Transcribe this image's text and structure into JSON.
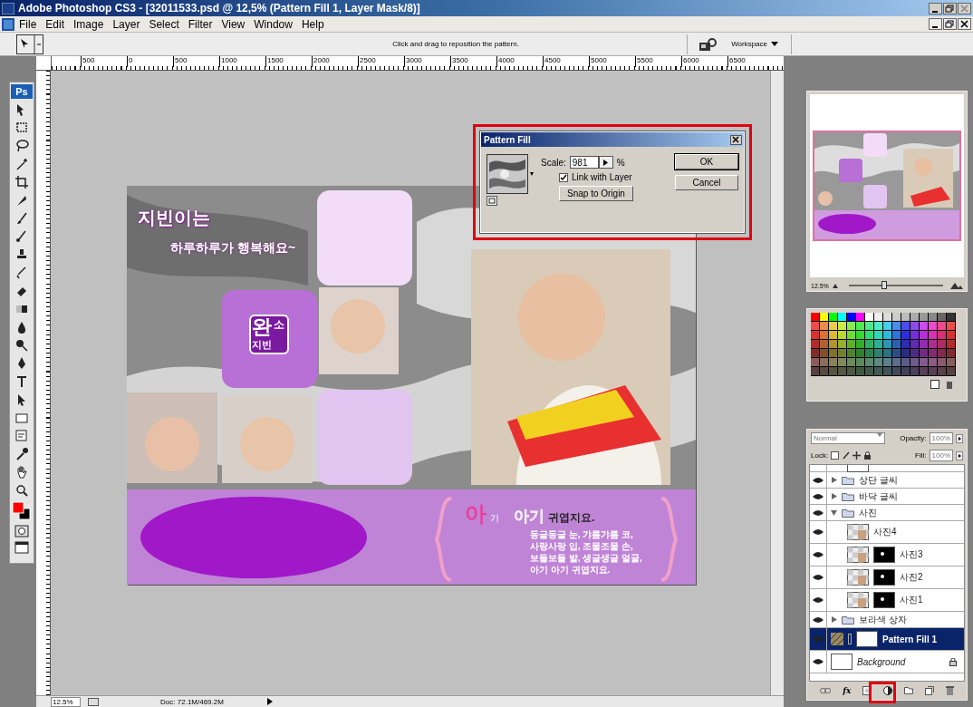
{
  "window": {
    "title": "Adobe Photoshop CS3 - [32011533.psd @ 12,5% (Pattern Fill 1, Layer Mask/8)]"
  },
  "menu": [
    "File",
    "Edit",
    "Image",
    "Layer",
    "Select",
    "Filter",
    "View",
    "Window",
    "Help"
  ],
  "options_bar": {
    "hint": "Click and drag to reposition the pattern.",
    "workspace": "Workspace"
  },
  "ruler": [
    "500",
    "0",
    "500",
    "1000",
    "1500",
    "2000",
    "2500",
    "3000",
    "3500",
    "4000",
    "4500",
    "5000",
    "5500",
    "6000",
    "6500"
  ],
  "toolbox": {
    "logo": "Ps"
  },
  "document": {
    "heading": "지빈이는",
    "tagline": "하루하루가 행복해요~",
    "logo": [
      "완",
      "소",
      "지빈"
    ],
    "caption_big": "아",
    "caption_small": "기",
    "caption_word": "아기",
    "caption_bold": "귀엽지요.",
    "poem": [
      "동글동글 눈, 갸름갸름 코,",
      "사랑사랑 입, 조물조물 손,",
      "보들보들 발, 생글생글 얼굴,",
      "아기 아기 귀엽지요."
    ]
  },
  "dialog": {
    "title": "Pattern Fill",
    "scale_label": "Scale:",
    "scale": "981",
    "unit": "%",
    "link_label": "Link with Layer",
    "link_checked": true,
    "snap": "Snap to Origin",
    "ok": "OK",
    "cancel": "Cancel"
  },
  "navigator": {
    "zoom": "12.5%",
    "level": 0.35
  },
  "layers": {
    "blend_mode": "Normal",
    "opacity_label": "Opacity:",
    "opacity": "100%",
    "lock_label": "Lock:",
    "fill_label": "Fill:",
    "fill": "100%",
    "fx_button": "fx",
    "items": [
      {
        "kind": "group",
        "name": "상단 글씨",
        "expanded": false,
        "selected": false
      },
      {
        "kind": "group",
        "name": "바닥 글씨",
        "expanded": false,
        "selected": false
      },
      {
        "kind": "group",
        "name": "사진",
        "expanded": true,
        "selected": false,
        "children": [
          {
            "kind": "layer",
            "name": "사진4",
            "selected": false
          },
          {
            "kind": "masked",
            "name": "사진3",
            "selected": false
          },
          {
            "kind": "masked",
            "name": "사진2",
            "selected": false
          },
          {
            "kind": "masked",
            "name": "사진1",
            "selected": false
          }
        ]
      },
      {
        "kind": "group",
        "name": "보라색 상자",
        "expanded": false,
        "selected": false
      },
      {
        "kind": "fill",
        "name": "Pattern Fill 1",
        "selected": true
      },
      {
        "kind": "background",
        "name": "Background",
        "selected": false
      }
    ]
  },
  "status_bar": {
    "zoom": "12.5%",
    "doc": "Doc: 72.1M/469.2M"
  }
}
